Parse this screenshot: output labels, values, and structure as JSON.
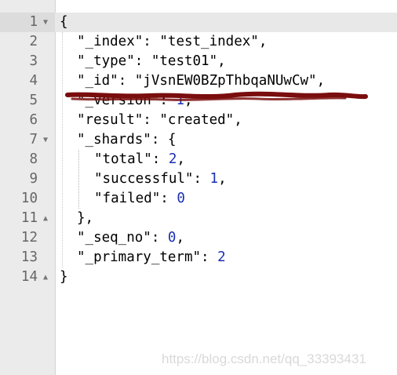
{
  "editor": {
    "lines": [
      {
        "num": "1",
        "fold": "▼",
        "tokens": [
          {
            "t": "{",
            "c": "p"
          }
        ],
        "indent": 0
      },
      {
        "num": "2",
        "fold": "",
        "tokens": [
          {
            "t": "\"_index\"",
            "c": "k"
          },
          {
            "t": ": ",
            "c": "p"
          },
          {
            "t": "\"test_index\"",
            "c": "s"
          },
          {
            "t": ",",
            "c": "p"
          }
        ],
        "indent": 1
      },
      {
        "num": "3",
        "fold": "",
        "tokens": [
          {
            "t": "\"_type\"",
            "c": "k"
          },
          {
            "t": ": ",
            "c": "p"
          },
          {
            "t": "\"test01\"",
            "c": "s"
          },
          {
            "t": ",",
            "c": "p"
          }
        ],
        "indent": 1
      },
      {
        "num": "4",
        "fold": "",
        "tokens": [
          {
            "t": "\"_id\"",
            "c": "k"
          },
          {
            "t": ": ",
            "c": "p"
          },
          {
            "t": "\"jVsnEW0BZpThbqaNUwCw\"",
            "c": "s"
          },
          {
            "t": ",",
            "c": "p"
          }
        ],
        "indent": 1
      },
      {
        "num": "5",
        "fold": "",
        "tokens": [
          {
            "t": "\"_version\"",
            "c": "k"
          },
          {
            "t": ": ",
            "c": "p"
          },
          {
            "t": "1",
            "c": "n"
          },
          {
            "t": ",",
            "c": "p"
          }
        ],
        "indent": 1
      },
      {
        "num": "6",
        "fold": "",
        "tokens": [
          {
            "t": "\"result\"",
            "c": "k"
          },
          {
            "t": ": ",
            "c": "p"
          },
          {
            "t": "\"created\"",
            "c": "s"
          },
          {
            "t": ",",
            "c": "p"
          }
        ],
        "indent": 1
      },
      {
        "num": "7",
        "fold": "▼",
        "tokens": [
          {
            "t": "\"_shards\"",
            "c": "k"
          },
          {
            "t": ": {",
            "c": "p"
          }
        ],
        "indent": 1
      },
      {
        "num": "8",
        "fold": "",
        "tokens": [
          {
            "t": "\"total\"",
            "c": "k"
          },
          {
            "t": ": ",
            "c": "p"
          },
          {
            "t": "2",
            "c": "n"
          },
          {
            "t": ",",
            "c": "p"
          }
        ],
        "indent": 2
      },
      {
        "num": "9",
        "fold": "",
        "tokens": [
          {
            "t": "\"successful\"",
            "c": "k"
          },
          {
            "t": ": ",
            "c": "p"
          },
          {
            "t": "1",
            "c": "n"
          },
          {
            "t": ",",
            "c": "p"
          }
        ],
        "indent": 2
      },
      {
        "num": "10",
        "fold": "",
        "tokens": [
          {
            "t": "\"failed\"",
            "c": "k"
          },
          {
            "t": ": ",
            "c": "p"
          },
          {
            "t": "0",
            "c": "n"
          }
        ],
        "indent": 2
      },
      {
        "num": "11",
        "fold": "▲",
        "tokens": [
          {
            "t": "},",
            "c": "p"
          }
        ],
        "indent": 1
      },
      {
        "num": "12",
        "fold": "",
        "tokens": [
          {
            "t": "\"_seq_no\"",
            "c": "k"
          },
          {
            "t": ": ",
            "c": "p"
          },
          {
            "t": "0",
            "c": "n"
          },
          {
            "t": ",",
            "c": "p"
          }
        ],
        "indent": 1
      },
      {
        "num": "13",
        "fold": "",
        "tokens": [
          {
            "t": "\"_primary_term\"",
            "c": "k"
          },
          {
            "t": ": ",
            "c": "p"
          },
          {
            "t": "2",
            "c": "n"
          }
        ],
        "indent": 1
      },
      {
        "num": "14",
        "fold": "▲",
        "tokens": [
          {
            "t": "}",
            "c": "p"
          }
        ],
        "indent": 0
      }
    ],
    "colors": {
      "gutter": "#ebebeb",
      "number_value": "#1a2fb3",
      "annotation_stroke": "#7a0d0d"
    }
  },
  "watermark": "https://blog.csdn.net/qq_33393431"
}
